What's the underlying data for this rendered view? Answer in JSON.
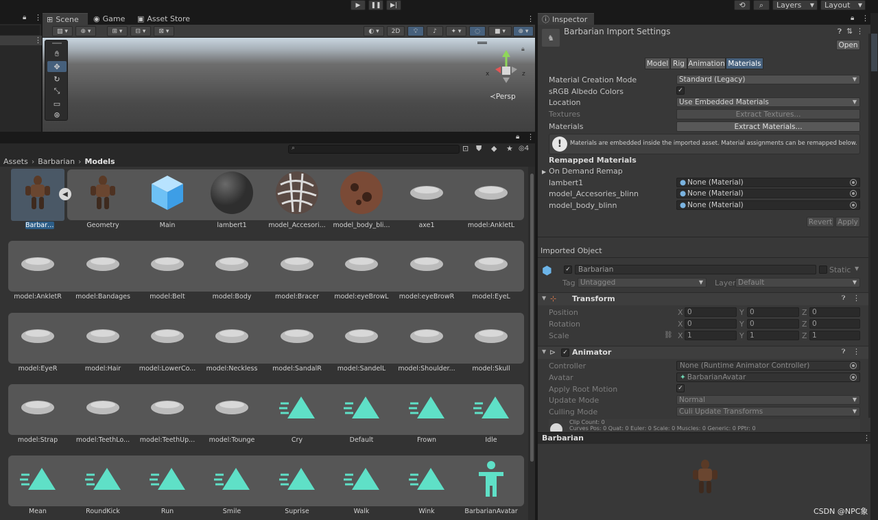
{
  "scene_tabs": {
    "scene": "Scene",
    "game": "Game",
    "asset_store": "Asset Store"
  },
  "scene_toolbar": {
    "mode_2d": "2D",
    "persp": "Persp",
    "gizmo_x": "x",
    "gizmo_z": "z"
  },
  "topbar": {
    "layers": "Layers",
    "layout": "Layout"
  },
  "project": {
    "badge_count": "4",
    "breadcrumb": [
      "Assets",
      "Barbarian",
      "Models"
    ],
    "rows": [
      [
        "Barbarian",
        "Geometry",
        "Main",
        "lambert1",
        "model_Accesori...",
        "model_body_bli...",
        "axe1",
        "model:AnkletL"
      ],
      [
        "model:AnkletR",
        "model:Bandages",
        "model:Belt",
        "model:Body",
        "model:Bracer",
        "model:eyeBrowL",
        "model:eyeBrowR",
        "model:EyeL"
      ],
      [
        "model:EyeR",
        "model:Hair",
        "model:LowerCo...",
        "model:Neckless",
        "model:SandalR",
        "model:SandelL",
        "model:Shoulder...",
        "model:Skull"
      ],
      [
        "model:Strap",
        "model:TeethLo...",
        "model:TeethUp...",
        "model:Tounge",
        "Cry",
        "Default",
        "Frown",
        "Idle"
      ],
      [
        "Mean",
        "RoundKick",
        "Run",
        "Smile",
        "Suprise",
        "Walk",
        "Wink",
        "BarbarianAvatar"
      ]
    ]
  },
  "inspector": {
    "tab": "Inspector",
    "title": "Barbarian Import Settings",
    "open": "Open",
    "tabs": [
      "Model",
      "Rig",
      "Animation",
      "Materials"
    ],
    "material_creation_mode_label": "Material Creation Mode",
    "material_creation_mode_value": "Standard (Legacy)",
    "srgb_label": "sRGB Albedo Colors",
    "location_label": "Location",
    "location_value": "Use Embedded Materials",
    "textures_label": "Textures",
    "extract_textures": "Extract Textures...",
    "materials_label": "Materials",
    "extract_materials": "Extract Materials...",
    "info_text": "Materials are embedded inside the imported asset. Material assignments can be remapped below.",
    "remapped_header": "Remapped Materials",
    "on_demand": "On Demand Remap",
    "remaps": [
      {
        "name": "lambert1",
        "value": "None (Material)"
      },
      {
        "name": "model_Accesories_blinn",
        "value": "None (Material)"
      },
      {
        "name": "model_body_blinn",
        "value": "None (Material)"
      }
    ],
    "revert": "Revert",
    "apply": "Apply",
    "imported_object": "Imported Object",
    "object_name": "Barbarian",
    "static": "Static",
    "tag_label": "Tag",
    "tag_value": "Untagged",
    "layer_label": "Layer",
    "layer_value": "Default",
    "transform": {
      "title": "Transform",
      "position": "Position",
      "rotation": "Rotation",
      "scale": "Scale",
      "x": "X",
      "y": "Y",
      "z": "Z",
      "pos": [
        "0",
        "0",
        "0"
      ],
      "rot": [
        "0",
        "0",
        "0"
      ],
      "scl": [
        "1",
        "1",
        "1"
      ]
    },
    "animator": {
      "title": "Animator",
      "controller_label": "Controller",
      "controller_value": "None (Runtime Animator Controller)",
      "avatar_label": "Avatar",
      "avatar_value": "BarbarianAvatar",
      "root_motion_label": "Apply Root Motion",
      "update_mode_label": "Update Mode",
      "update_mode_value": "Normal",
      "culling_label": "Culling Mode",
      "culling_value": "Culi Update Transforms",
      "clip_count": "Clip Count: 0",
      "curves": "Curves Pos: 0 Quat: 0 Euler: 0 Scale: 0 Muscles: 0 Generic: 0 PPtr: 0"
    },
    "preview_title": "Barbarian"
  },
  "watermark": "CSDN @NPC象"
}
